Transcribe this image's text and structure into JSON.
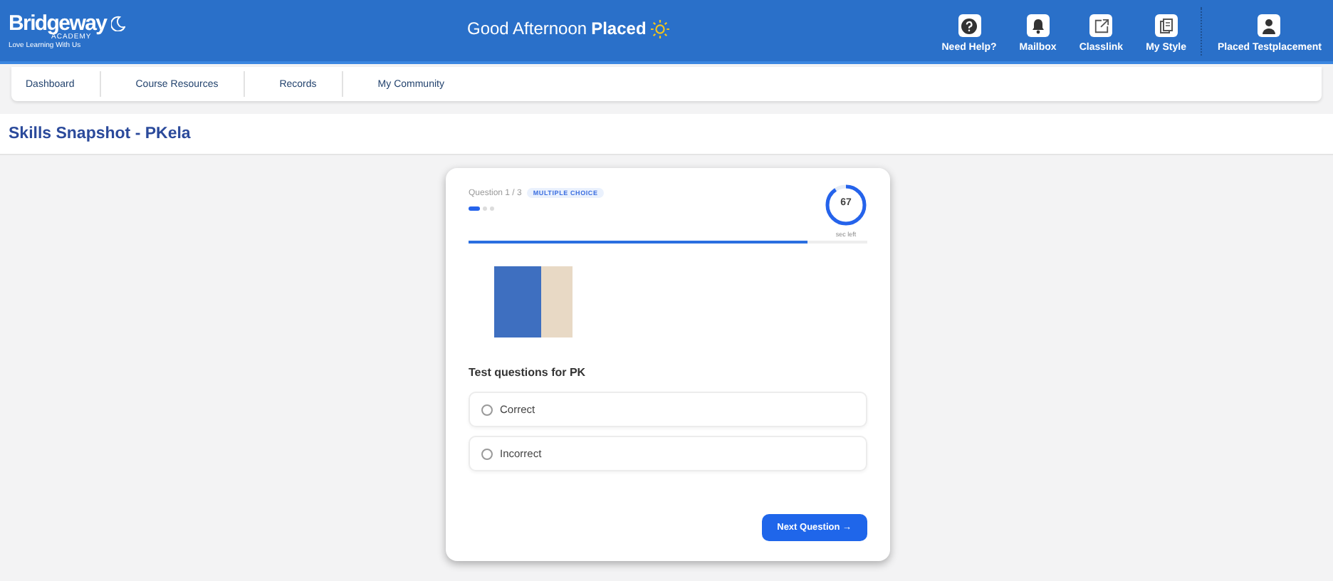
{
  "header": {
    "logo": "Bridgeway",
    "logo_sub": "ACADEMY",
    "tagline": "Love Learning With Us",
    "greeting": "Good Afternoon",
    "user_first": "Placed",
    "actions": [
      {
        "kind": "help",
        "label": "Need Help?"
      },
      {
        "kind": "bell",
        "label": "Mailbox"
      },
      {
        "kind": "external",
        "label": "Classlink"
      },
      {
        "kind": "style",
        "label": "My Style"
      },
      {
        "kind": "user",
        "label": "Placed Testplacement"
      }
    ]
  },
  "nav": [
    {
      "label": "Dashboard"
    },
    {
      "label": "Course Resources"
    },
    {
      "label": "Records"
    },
    {
      "label": "My Community"
    }
  ],
  "page_title": "Skills Snapshot - PKela",
  "quiz": {
    "counter": "Question 1 / 3",
    "type_badge": "MULTIPLE CHOICE",
    "steps": [
      {
        "selected": true
      },
      {
        "selected": false
      },
      {
        "selected": false
      }
    ],
    "timer": {
      "value": "67",
      "caption": "sec left",
      "level": 0.9
    },
    "progress": {
      "level": 0.85
    },
    "question": "Test questions for PK",
    "options": [
      {
        "label": "Correct",
        "selected": false
      },
      {
        "label": "Incorrect",
        "selected": false
      }
    ],
    "next_button": "Next Question →"
  }
}
